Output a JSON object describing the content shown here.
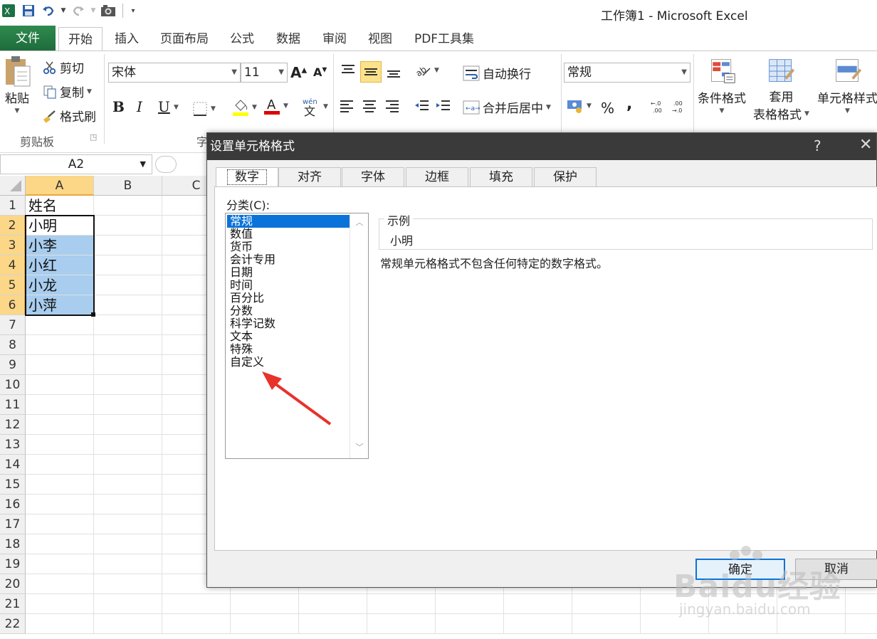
{
  "titlebar": {
    "title": "工作簿1 - Microsoft Excel"
  },
  "ribbon_tabs": [
    "文件",
    "开始",
    "插入",
    "页面布局",
    "公式",
    "数据",
    "审阅",
    "视图",
    "PDF工具集"
  ],
  "clipboard": {
    "paste": "粘贴",
    "cut": "剪切",
    "copy": "复制",
    "format_painter": "格式刷",
    "group_label": "剪贴板"
  },
  "font": {
    "name": "宋体",
    "size": "11",
    "bold": "B",
    "italic": "I",
    "underline": "U",
    "group_label_partial": "字"
  },
  "alignment": {
    "wrap_text": "自动换行",
    "merge_center": "合并后居中"
  },
  "number": {
    "format": "常规",
    "percent": "%",
    "comma": ","
  },
  "styles": {
    "conditional": "条件格式",
    "table_format_1": "套用",
    "table_format_2": "表格格式",
    "cell_styles": "单元格样式"
  },
  "formula_bar": {
    "name_box": "A2"
  },
  "grid": {
    "columns": [
      "A",
      "B",
      "C"
    ],
    "rows": [
      "1",
      "2",
      "3",
      "4",
      "5",
      "6",
      "7",
      "8",
      "9",
      "10",
      "11",
      "12",
      "13",
      "14",
      "15",
      "16",
      "17",
      "18",
      "19",
      "20",
      "21",
      "22"
    ],
    "cells_a": [
      "姓名",
      "小明",
      "小李",
      "小红",
      "小龙",
      "小萍"
    ]
  },
  "dialog": {
    "title": "设置单元格格式",
    "help": "?",
    "close": "✕",
    "tabs": [
      "数字",
      "对齐",
      "字体",
      "边框",
      "填充",
      "保护"
    ],
    "category_label": "分类(C):",
    "categories": [
      "常规",
      "数值",
      "货币",
      "会计专用",
      "日期",
      "时间",
      "百分比",
      "分数",
      "科学记数",
      "文本",
      "特殊",
      "自定义"
    ],
    "selected_category": "常规",
    "sample_label": "示例",
    "sample_value": "小明",
    "description": "常规单元格格式不包含任何特定的数字格式。",
    "ok": "确定",
    "cancel": "取消"
  },
  "watermark": {
    "brand": "Baidu经验",
    "url": "jingyan.baidu.com"
  },
  "colors": {
    "excel_green": "#217346",
    "selection_blue": "#0a73d9",
    "header_highlight": "#fbd787",
    "cell_selection": "#a8cdee",
    "annotation_red": "#e8322a"
  }
}
